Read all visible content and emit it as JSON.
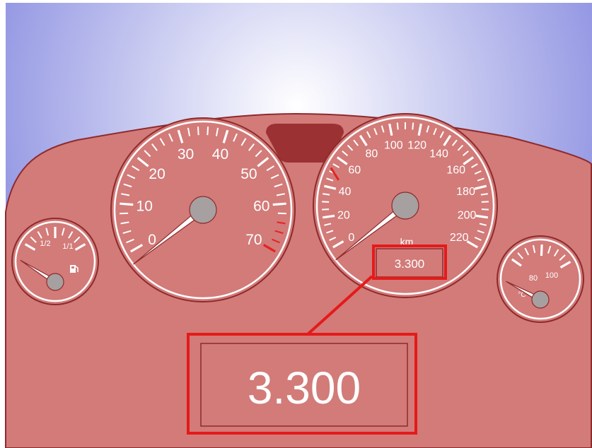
{
  "colors": {
    "panel": "#D27B79",
    "outline": "#8E2A2C",
    "vent": "#9B3133",
    "hub": "#A6A0A0",
    "redline": "#E52222",
    "callout": "#E51A1A",
    "sky_center": "#FFFFFF",
    "sky_edge": "#8D91E1"
  },
  "tachometer": {
    "labels": [
      "0",
      "10",
      "20",
      "30",
      "40",
      "50",
      "60",
      "70"
    ]
  },
  "speedometer": {
    "labels": [
      "0",
      "20",
      "40",
      "60",
      "80",
      "100",
      "120",
      "140",
      "160",
      "180",
      "200",
      "220"
    ],
    "unit": "km"
  },
  "fuel_gauge": {
    "labels": [
      "1/2",
      "1/1"
    ],
    "icon": "fuel-pump-icon"
  },
  "temp_gauge": {
    "labels": [
      "80",
      "100"
    ],
    "unit": "°C"
  },
  "odometer": {
    "value": "3.300",
    "zoom_value": "3.300"
  }
}
